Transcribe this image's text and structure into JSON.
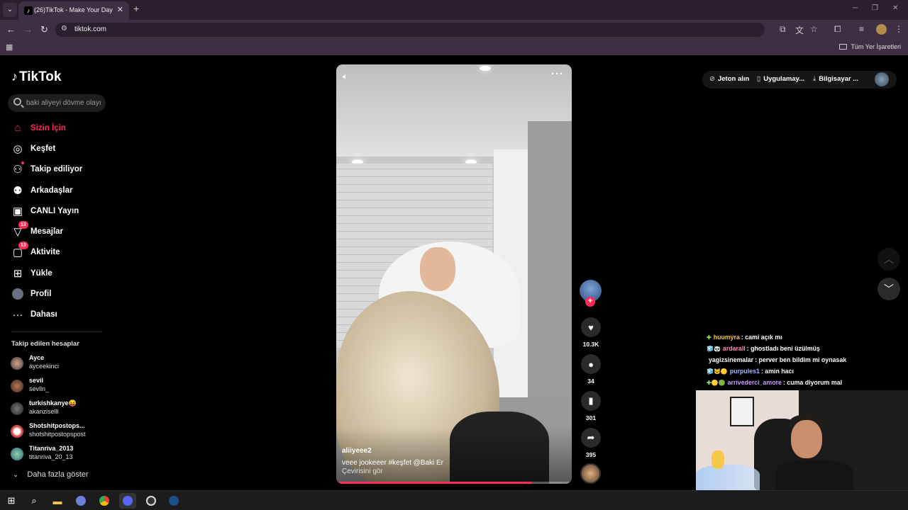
{
  "browser": {
    "tab_title": "(26)TikTok - Make Your Day",
    "url": "tiktok.com",
    "bookmarks_all": "Tüm Yer İşaretleri"
  },
  "sidebar": {
    "logo": "TikTok",
    "search_placeholder": "baki aliyeyi dövme olayı",
    "nav": [
      {
        "label": "Sizin İçin",
        "icon": "home-icon",
        "active": true
      },
      {
        "label": "Keşfet",
        "icon": "compass-icon"
      },
      {
        "label": "Takip ediliyor",
        "icon": "user-follow-icon"
      },
      {
        "label": "Arkadaşlar",
        "icon": "friends-icon"
      },
      {
        "label": "CANLI Yayın",
        "icon": "live-tv-icon"
      },
      {
        "label": "Mesajlar",
        "icon": "message-icon",
        "badge": "13"
      },
      {
        "label": "Aktivite",
        "icon": "activity-icon",
        "badge": "13"
      },
      {
        "label": "Yükle",
        "icon": "upload-icon"
      },
      {
        "label": "Profil",
        "icon": "profile-avatar"
      },
      {
        "label": "Dahası",
        "icon": "more-dots-icon"
      }
    ],
    "following_title": "Takip edilen hesaplar",
    "following": [
      {
        "name": "Ayce",
        "handle": "ayceekinci"
      },
      {
        "name": "sevil",
        "handle": "sevlln_"
      },
      {
        "name": "turkishkanye😝",
        "handle": "akanziselll"
      },
      {
        "name": "Shotshitpostops...",
        "handle": "shotshitpostopspost"
      },
      {
        "name": "Titanriva_2013",
        "handle": "titanriva_20_13"
      }
    ],
    "show_more": "Daha fazla göster"
  },
  "video": {
    "author": "aliiyeee2",
    "caption": "veee jookeeer #keşfet  @Baki Er",
    "translate": "Çevirisini gör",
    "progress": 0.83,
    "likes": "10.3K",
    "comments": "34",
    "saves": "301",
    "shares": "395"
  },
  "header_right": {
    "coins": "Jeton alın",
    "app": "Uygulamay...",
    "desktop": "Bilgisayar ..."
  },
  "chat": [
    {
      "badges": "✚",
      "user": "huumyra",
      "user_color": "#f5c542",
      "text": ": cami açık mı"
    },
    {
      "badges": "🧊🐼",
      "user": "ardarall",
      "user_color": "#ff8fb0",
      "text": ": ghostladı beni üzülmüş"
    },
    {
      "badges": "",
      "user": "yagizsinemalar",
      "user_color": "#ffffff",
      "text": ": perver ben bildim mi oynasak"
    },
    {
      "badges": "🧊🐱🟡",
      "user": "purpules1",
      "user_color": "#9db8ff",
      "text": ": amin hacı"
    },
    {
      "badges": "✚🟡🟢",
      "user": "arrivederci_amore",
      "user_color": "#c79bff",
      "text": ": cuma diyorum mal"
    }
  ]
}
